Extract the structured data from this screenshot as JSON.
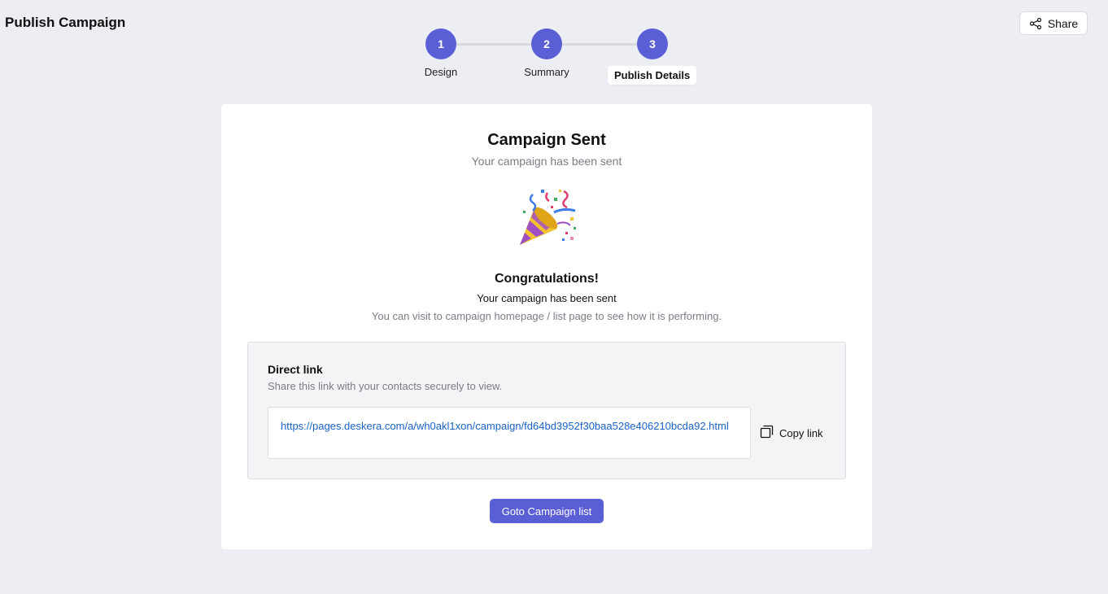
{
  "header": {
    "title": "Publish Campaign",
    "share_label": "Share",
    "share_icon": "share-nodes-icon"
  },
  "stepper": {
    "steps": [
      {
        "number": "1",
        "label": "Design"
      },
      {
        "number": "2",
        "label": "Summary"
      },
      {
        "number": "3",
        "label": "Publish Details"
      }
    ],
    "active_step": 3,
    "accent_color": "#5b5fd6"
  },
  "card": {
    "title": "Campaign Sent",
    "subtitle": "Your campaign has been sent",
    "illustration": "party-popper-icon",
    "congrats_title": "Congratulations!",
    "congrats_subtitle": "Your campaign has been sent",
    "congrats_hint": "You can visit to campaign homepage / list page to see how it is performing."
  },
  "direct_link": {
    "title": "Direct link",
    "description": "Share this link with your contacts securely to view.",
    "url": "https://pages.deskera.com/a/wh0akl1xon/campaign/fd64bd3952f30baa528e406210bcda92.html",
    "copy_label": "Copy link",
    "copy_icon": "copy-icon"
  },
  "actions": {
    "goto_label": "Goto Campaign list"
  }
}
